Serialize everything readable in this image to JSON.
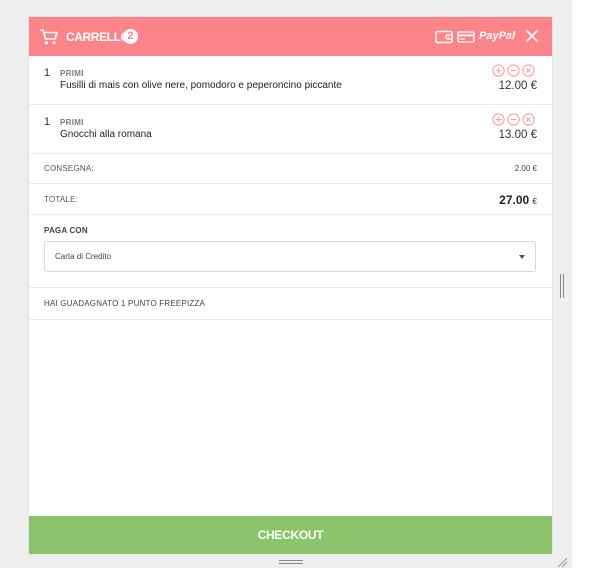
{
  "header": {
    "title": "CARRELLO",
    "count": "2",
    "paypal_label": "PayPal"
  },
  "items": [
    {
      "qty": "1",
      "category": "PRIMI",
      "name": "Fusilli di mais con olive nere, pomodoro e peperoncino piccante",
      "price": "12.00 €"
    },
    {
      "qty": "1",
      "category": "PRIMI",
      "name": "Gnocchi alla romana",
      "price": "13.00 €"
    }
  ],
  "delivery": {
    "label": "CONSEGNA:",
    "value": "2.00 €"
  },
  "total": {
    "label": "TOTALE:",
    "value": "27.00",
    "currency": "€"
  },
  "payment": {
    "label": "PAGA CON",
    "selected": "Carta di Credito"
  },
  "points": {
    "text": "HAI GUADAGNATO 1 PUNTO FREEPIZZA"
  },
  "checkout": {
    "label": "CHECKOUT"
  },
  "colors": {
    "header": "#fd858a",
    "checkout": "#8ac46b",
    "item_controls": "#f4a3a6"
  }
}
